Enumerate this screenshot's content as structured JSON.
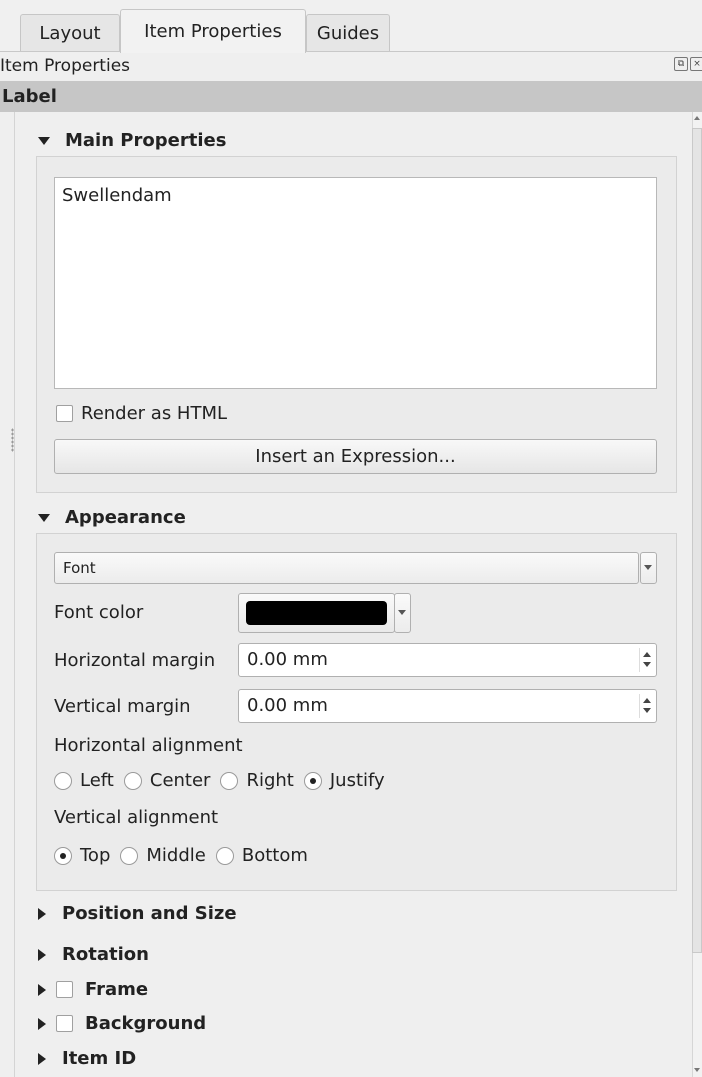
{
  "tabs": [
    {
      "label": "Layout"
    },
    {
      "label": "Item Properties"
    },
    {
      "label": "Guides"
    }
  ],
  "dock": {
    "title": "Item Properties"
  },
  "item_type": "Label",
  "main_properties": {
    "title": "Main Properties",
    "label_text": "Swellendam",
    "render_html_label": "Render as HTML",
    "render_html_checked": false,
    "insert_expression_label": "Insert an Expression..."
  },
  "appearance": {
    "title": "Appearance",
    "font_button_label": "Font",
    "font_color_label": "Font color",
    "font_color_value": "#000000",
    "horizontal_margin_label": "Horizontal margin",
    "horizontal_margin_value": "0.00 mm",
    "vertical_margin_label": "Vertical margin",
    "vertical_margin_value": "0.00 mm",
    "horizontal_alignment_label": "Horizontal alignment",
    "horizontal_alignment_options": [
      "Left",
      "Center",
      "Right",
      "Justify"
    ],
    "horizontal_alignment_selected": "Justify",
    "vertical_alignment_label": "Vertical alignment",
    "vertical_alignment_options": [
      "Top",
      "Middle",
      "Bottom"
    ],
    "vertical_alignment_selected": "Top"
  },
  "collapsed_sections": [
    {
      "label": "Position and Size",
      "has_checkbox": false
    },
    {
      "label": "Rotation",
      "has_checkbox": false
    },
    {
      "label": "Frame",
      "has_checkbox": true,
      "checked": false
    },
    {
      "label": "Background",
      "has_checkbox": true,
      "checked": false
    },
    {
      "label": "Item ID",
      "has_checkbox": false
    }
  ]
}
